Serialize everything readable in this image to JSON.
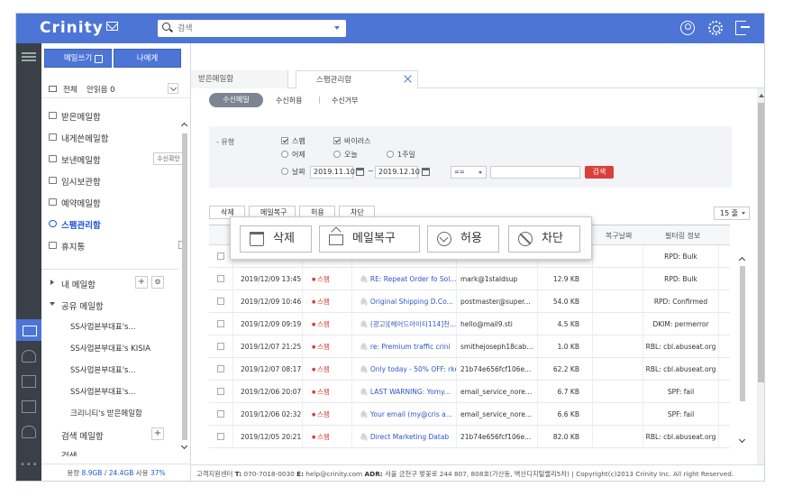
{
  "app": {
    "logo": "Crinity"
  },
  "search": {
    "placeholder": "검색"
  },
  "sidebar": {
    "write_label": "메일쓰기",
    "self_label": "나에게",
    "all_label": "전체",
    "unread_label": "안읽음 0",
    "folders": [
      {
        "label": "받은메일함"
      },
      {
        "label": "내게쓴메일함"
      },
      {
        "label": "보낸메일함",
        "badge": "수신확인"
      },
      {
        "label": "임시보관함"
      },
      {
        "label": "예약메일함"
      },
      {
        "label": "스팸관리함"
      },
      {
        "label": "휴지통"
      }
    ],
    "my_mail": "내 메일함",
    "shared_mail": "공유 메일함",
    "shared_items": [
      "SS사업본부대표's...",
      "SS사업본부대표's KISIA",
      "SS사업본부대표's...",
      "SS사업본부대표's...",
      "크리니티's 받은메일함"
    ],
    "search_mail": "검색 메일함",
    "cutoff": "검색",
    "quota_prefix": "용량 ",
    "quota_used": "8.9GB",
    "quota_sep": " / ",
    "quota_total": "24.4GB",
    "quota_mid": " 사용 ",
    "quota_pct": "37%"
  },
  "tabs": {
    "inbox": "받은메일함",
    "spam": "스팸관리함"
  },
  "subtabs": {
    "recv": "수신메일",
    "allow": "수신허용",
    "sep": "|",
    "deny": "수신거부"
  },
  "filter": {
    "type_label": "- 유형",
    "spam": "스팸",
    "virus": "바이러스",
    "yesterday": "어제",
    "today": "오늘",
    "week": "1주일",
    "date": "날짜",
    "date_from": "2019.11.10",
    "date_to": "2019.12.10",
    "tilde": "~",
    "eq": "==",
    "search_btn": "검색"
  },
  "toolbar_small": {
    "delete": "삭제",
    "restore": "메일복구",
    "allow": "허용",
    "block": "차단",
    "per_page": "15 줄"
  },
  "grid": {
    "headers": {
      "restore_date": "복구날짜",
      "filter_info": "필터링 정보"
    },
    "rows": [
      {
        "date": "",
        "type": "",
        "subject": "",
        "from": "",
        "size": "",
        "info": "RPD: Bulk"
      },
      {
        "date": "2019/12/09 13:45",
        "type": "스팸",
        "subject": "RE: Repeat Order fo Sol...",
        "from": "mark@1staldsup",
        "size": "12.9 KB",
        "info": "RPD: Bulk"
      },
      {
        "date": "2019/12/09 10:46",
        "type": "스팸",
        "subject": "Original Shipping D.Co...",
        "from": "postmaster@super...",
        "size": "54.0 KB",
        "info": "RPD: Confirmed"
      },
      {
        "date": "2019/12/09 09:19",
        "type": "스팸",
        "subject": "(광고)[헤어드아이티114]천...",
        "from": "hello@mail9.sti",
        "size": "4.5 KB",
        "info": "DKIM: permerror"
      },
      {
        "date": "2019/12/07 21:25",
        "type": "스팸",
        "subject": "re: Premium traffic crini",
        "from": "smithejoseph18cab...",
        "size": "1.0 KB",
        "info": "RBL: cbl.abuseat.org"
      },
      {
        "date": "2019/12/07 08:17",
        "type": "스팸",
        "subject": "Only today - 50% OFF: rke...",
        "from": "21b74e656fcf106e...",
        "size": "62.2 KB",
        "info": "RBL: cbl.abuseat.org"
      },
      {
        "date": "2019/12/06 20:07",
        "type": "스팸",
        "subject": "LAST WARNING: Yomy...",
        "from": "email_service_nore...",
        "size": "6.7 KB",
        "info": "SPF: fail"
      },
      {
        "date": "2019/12/06 02:32",
        "type": "스팸",
        "subject": "Your email (my@cris a...",
        "from": "email_service_nore...",
        "size": "6.6 KB",
        "info": "SPF: fail"
      },
      {
        "date": "2019/12/05 20:21",
        "type": "스팸",
        "subject": "Direct Marketing Datab",
        "from": "21b74e656fcf106e...",
        "size": "82.0 KB",
        "info": "RBL: cbl.abuseat.org"
      }
    ]
  },
  "callout": {
    "delete": "삭제",
    "restore": "메일복구",
    "allow": "허용",
    "block": "차단"
  },
  "footer": {
    "center": "고객지원센터",
    "t_label": "T:",
    "tel": "070-7018-0030",
    "e_label": "E:",
    "email": "help@crinity.com",
    "adr_label": "ADR:",
    "address": "서울 금천구 벚꽃로 244 807, 808호(가산동, 벽산디지털밸리5차) | Copyright(c)2013 Crinity Inc. All right Reserved."
  },
  "colors": {
    "brand": "#4d75d6",
    "rail": "#3b3f48",
    "spam_red": "#d9403a",
    "link_blue": "#2f55c9"
  }
}
